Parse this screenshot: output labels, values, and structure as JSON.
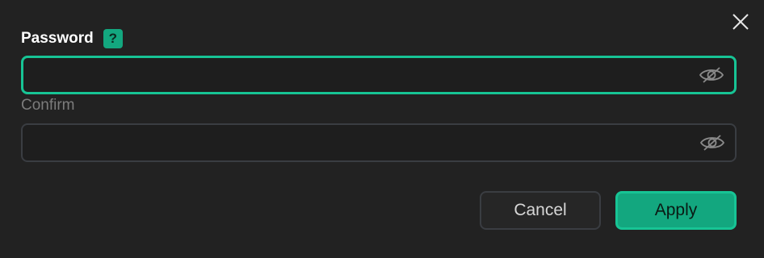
{
  "dialog": {
    "password_label": "Password",
    "help_badge": "?",
    "confirm_label": "Confirm",
    "password_value": "",
    "confirm_value": "",
    "cancel_label": "Cancel",
    "apply_label": "Apply"
  },
  "icons": {
    "close": "close-icon",
    "help": "help-icon",
    "visibility": "eye-off-icon"
  },
  "colors": {
    "background": "#222222",
    "accent": "#17c495",
    "accent_fill": "#13a77f",
    "border_inactive": "#3a3d42",
    "muted_text": "#7c7c7c"
  }
}
